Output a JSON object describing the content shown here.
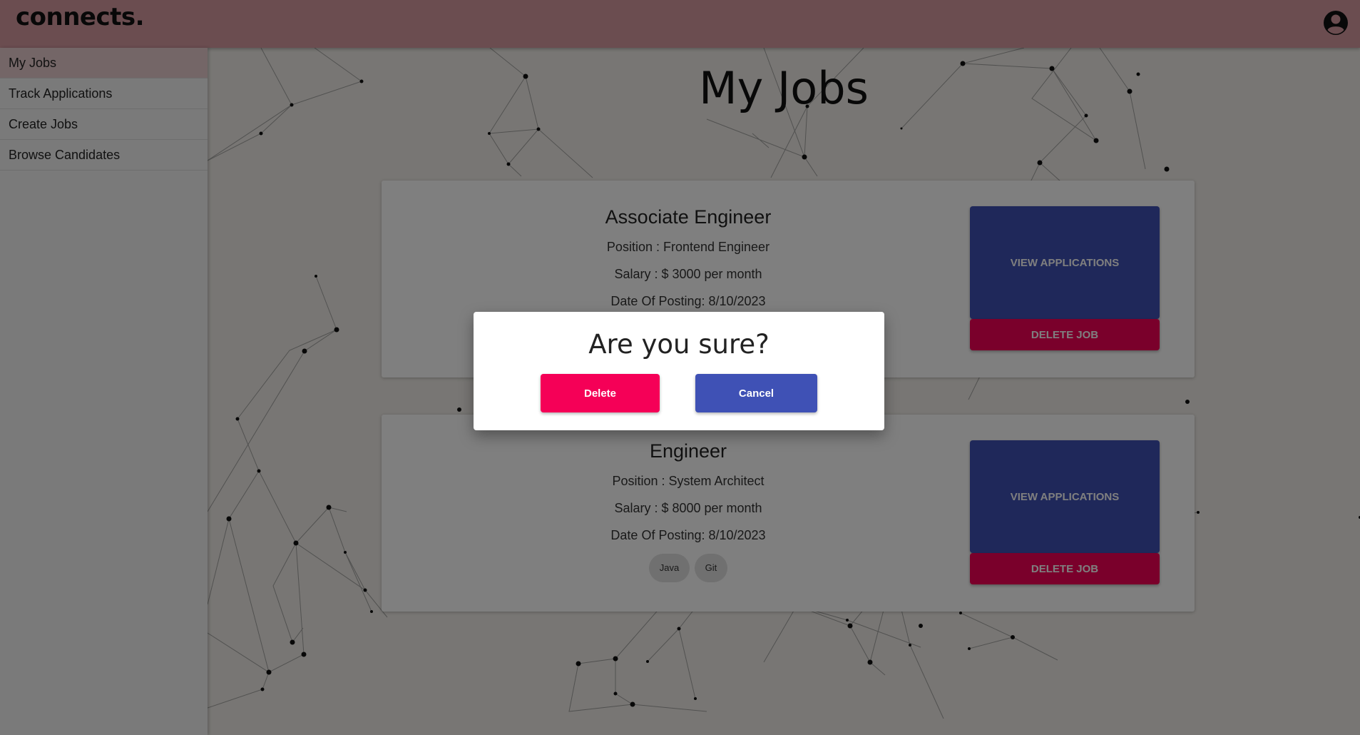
{
  "app": {
    "brand": "connects."
  },
  "header": {
    "account_icon": "account-circle-icon"
  },
  "sidebar": {
    "items": [
      {
        "label": "My Jobs",
        "active": true
      },
      {
        "label": "Track Applications",
        "active": false
      },
      {
        "label": "Create Jobs",
        "active": false
      },
      {
        "label": "Browse Candidates",
        "active": false
      }
    ]
  },
  "main": {
    "title": "My Jobs",
    "jobs": [
      {
        "title": "Associate Engineer",
        "position": "Position : Frontend Engineer",
        "salary": "Salary : $ 3000 per month",
        "date": "Date Of Posting: 8/10/2023",
        "skills": [],
        "view_label": "VIEW APPLICATIONS",
        "delete_label": "DELETE JOB"
      },
      {
        "title": "Engineer",
        "position": "Position : System Architect",
        "salary": "Salary : $ 8000 per month",
        "date": "Date Of Posting: 8/10/2023",
        "skills": [
          "Java",
          "Git"
        ],
        "view_label": "VIEW APPLICATIONS",
        "delete_label": "DELETE JOB"
      }
    ]
  },
  "dialog": {
    "title": "Are you sure?",
    "delete_label": "Delete",
    "cancel_label": "Cancel"
  },
  "colors": {
    "header": "#d69aa0",
    "primary": "#3f51b5",
    "danger": "#f50057",
    "background": "#f0ede8"
  }
}
